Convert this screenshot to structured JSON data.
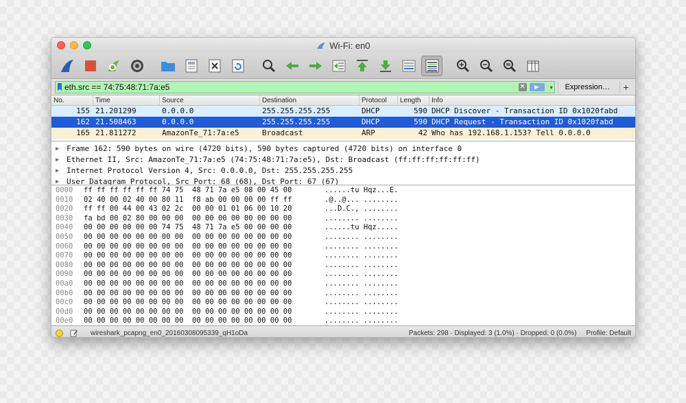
{
  "window": {
    "title": "Wi-Fi: en0"
  },
  "toolbar": {
    "icons": [
      "shark-fin-icon",
      "stop-icon",
      "restart-icon",
      "options-gear-icon",
      "open-folder-icon",
      "save-file-icon",
      "close-file-icon",
      "reload-icon",
      "find-icon",
      "back-icon",
      "forward-icon",
      "go-to-packet-icon",
      "first-packet-icon",
      "last-packet-icon",
      "auto-scroll-icon",
      "colorize-icon",
      "zoom-in-icon",
      "zoom-out-icon",
      "normal-size-icon",
      "resize-columns-icon"
    ]
  },
  "filter": {
    "value": "eth.src == 74:75:48:71:7a:e5",
    "expression_label": "Expression…",
    "plus_label": "+"
  },
  "packet_list": {
    "columns": [
      "No.",
      "Time",
      "Source",
      "Destination",
      "Protocol",
      "Length",
      "Info"
    ],
    "rows": [
      {
        "no": "155",
        "time": "21.201299",
        "src": "0.0.0.0",
        "dst": "255.255.255.255",
        "proto": "DHCP",
        "len": "590",
        "info": "DHCP Discover - Transaction ID 0x1020fabd",
        "style": "dhcp"
      },
      {
        "no": "162",
        "time": "21.508463",
        "src": "0.0.0.0",
        "dst": "255.255.255.255",
        "proto": "DHCP",
        "len": "590",
        "info": "DHCP Request  - Transaction ID 0x1020fabd",
        "style": "selected"
      },
      {
        "no": "165",
        "time": "21.811272",
        "src": "AmazonTe_71:7a:e5",
        "dst": "Broadcast",
        "proto": "ARP",
        "len": "42",
        "info": "Who has 192.168.1.153? Tell 0.0.0.0",
        "style": "arp"
      }
    ]
  },
  "details": [
    "Frame 162: 590 bytes on wire (4720 bits), 590 bytes captured (4720 bits) on interface 0",
    "Ethernet II, Src: AmazonTe_71:7a:e5 (74:75:48:71:7a:e5), Dst: Broadcast (ff:ff:ff:ff:ff:ff)",
    "Internet Protocol Version 4, Src: 0.0.0.0, Dst: 255.255.255.255",
    "User Datagram Protocol, Src Port: 68 (68), Dst Port: 67 (67)"
  ],
  "hex_dump": [
    {
      "off": "0000",
      "bytes": "ff ff ff ff ff ff 74 75  48 71 7a e5 08 00 45 00",
      "ascii": "......tu Hqz...E."
    },
    {
      "off": "0010",
      "bytes": "02 40 00 02 40 00 80 11  f8 ab 00 00 00 00 ff ff",
      "ascii": ".@..@... ........"
    },
    {
      "off": "0020",
      "bytes": "ff ff 00 44 00 43 02 2c  00 00 01 01 06 00 10 20",
      "ascii": "...D.C., ........"
    },
    {
      "off": "0030",
      "bytes": "fa bd 00 02 80 00 00 00  00 00 00 00 00 00 00 00",
      "ascii": "........ ........"
    },
    {
      "off": "0040",
      "bytes": "00 00 00 00 00 00 74 75  48 71 7a e5 00 00 00 00",
      "ascii": "......tu Hqz....."
    },
    {
      "off": "0050",
      "bytes": "00 00 00 00 00 00 00 00  00 00 00 00 00 00 00 00",
      "ascii": "........ ........"
    },
    {
      "off": "0060",
      "bytes": "00 00 00 00 00 00 00 00  00 00 00 00 00 00 00 00",
      "ascii": "........ ........"
    },
    {
      "off": "0070",
      "bytes": "00 00 00 00 00 00 00 00  00 00 00 00 00 00 00 00",
      "ascii": "........ ........"
    },
    {
      "off": "0080",
      "bytes": "00 00 00 00 00 00 00 00  00 00 00 00 00 00 00 00",
      "ascii": "........ ........"
    },
    {
      "off": "0090",
      "bytes": "00 00 00 00 00 00 00 00  00 00 00 00 00 00 00 00",
      "ascii": "........ ........"
    },
    {
      "off": "00a0",
      "bytes": "00 00 00 00 00 00 00 00  00 00 00 00 00 00 00 00",
      "ascii": "........ ........"
    },
    {
      "off": "00b0",
      "bytes": "00 00 00 00 00 00 00 00  00 00 00 00 00 00 00 00",
      "ascii": "........ ........"
    },
    {
      "off": "00c0",
      "bytes": "00 00 00 00 00 00 00 00  00 00 00 00 00 00 00 00",
      "ascii": "........ ........"
    },
    {
      "off": "00d0",
      "bytes": "00 00 00 00 00 00 00 00  00 00 00 00 00 00 00 00",
      "ascii": "........ ........"
    },
    {
      "off": "00e0",
      "bytes": "00 00 00 00 00 00 00 00  00 00 00 00 00 00 00 00",
      "ascii": "........ ........"
    }
  ],
  "status": {
    "file": "wireshark_pcapng_en0_20160308095339_qH1oDa",
    "stats": "Packets: 298 · Displayed: 3 (1.0%) · Dropped: 0 (0.0%)",
    "profile": "Profile: Default"
  },
  "colors": {
    "selected_row": "#1e5cd9",
    "dhcp_row": "#daeeff",
    "arp_row": "#faf0d7",
    "filter_valid": "#aff5b4"
  }
}
